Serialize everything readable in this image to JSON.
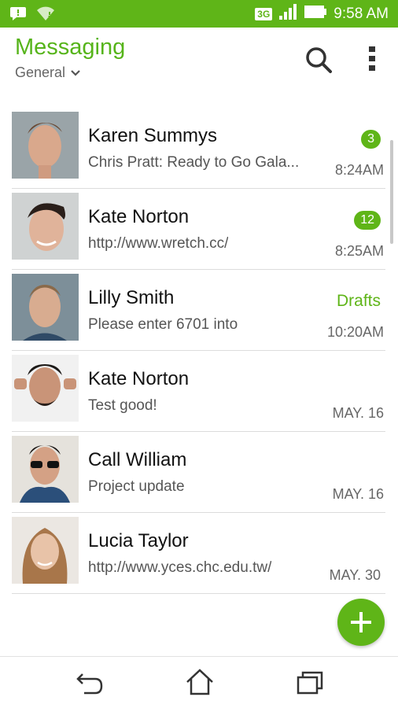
{
  "status_bar": {
    "network_type": "3G",
    "time": "9:58 AM",
    "icons": [
      "chat-notification-icon",
      "wifi-icon",
      "signal-icon",
      "battery-icon"
    ]
  },
  "header": {
    "title": "Messaging",
    "folder": "General",
    "actions": [
      "search-icon",
      "more-vert-icon"
    ]
  },
  "threads": [
    {
      "name": "Karen Summys",
      "snippet": "Chris Pratt: Ready to Go Gala...",
      "time": "8:24AM",
      "badge": "3",
      "status": ""
    },
    {
      "name": "Kate Norton",
      "snippet": "http://www.wretch.cc/",
      "time": "8:25AM",
      "badge": "12",
      "status": ""
    },
    {
      "name": "Lilly Smith",
      "snippet": "Please enter 6701 into",
      "time": "10:20AM",
      "badge": "",
      "status": "Drafts"
    },
    {
      "name": "Kate Norton",
      "snippet": "Test good!",
      "time": "MAY. 16",
      "badge": "",
      "status": ""
    },
    {
      "name": "Call William",
      "snippet": "Project update",
      "time": "MAY. 16",
      "badge": "",
      "status": ""
    },
    {
      "name": "Lucia Taylor",
      "snippet": "http://www.yces.chc.edu.tw/",
      "time": "MAY.  30",
      "badge": "",
      "status": ""
    }
  ],
  "colors": {
    "accent": "#5fb518",
    "title": "#56b41a",
    "divider": "#dcdcdc"
  },
  "nav": [
    "back-icon",
    "home-icon",
    "recent-apps-icon"
  ]
}
